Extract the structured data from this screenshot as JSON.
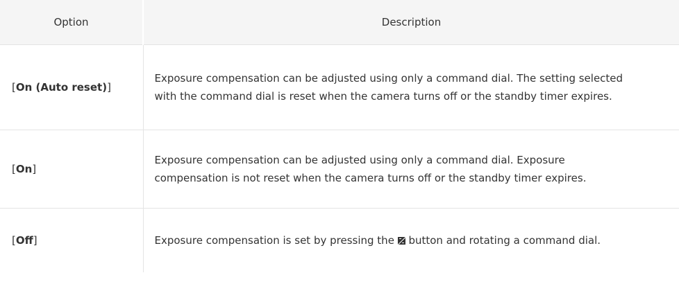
{
  "table": {
    "headers": {
      "option": "Option",
      "description": "Description"
    },
    "rows": [
      {
        "option_open": "[",
        "option": "On (Auto reset)",
        "option_close": "]",
        "description": "Exposure compensation can be adjusted using only a command dial. The setting selected with the command dial is reset when the camera turns off or the standby timer expires."
      },
      {
        "option_open": "[",
        "option": "On",
        "option_close": "]",
        "description": "Exposure compensation can be adjusted using only a command dial. Exposure compensation is not reset when the camera turns off or the standby timer expires."
      },
      {
        "option_open": "[",
        "option": "Off",
        "option_close": "]",
        "description_before": "Exposure compensation is set by pressing the ",
        "description_icon": "exposure-compensation-icon",
        "description_after": " button and rotating a command dial."
      }
    ]
  }
}
